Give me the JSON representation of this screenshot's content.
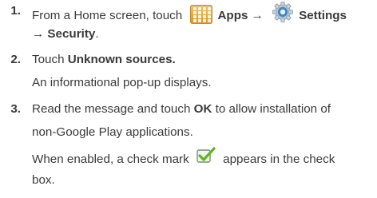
{
  "steps": [
    {
      "number": "1.",
      "line1_prefix": "From a Home screen, touch ",
      "apps_label": "Apps",
      "arrow1": " → ",
      "settings_label": "Settings",
      "line2": "→ Security",
      "line2_end": "."
    },
    {
      "number": "2.",
      "prefix": "Touch ",
      "unknown_sources": "Unknown sources.",
      "line2": "An informational pop-up displays."
    },
    {
      "number": "3.",
      "line1_prefix": "Read the message and touch ",
      "ok_label": "OK",
      "line1_suffix": " to allow installation of",
      "line2": "non-Google Play applications.",
      "line3_prefix": "When enabled, a check mark ",
      "line3_suffix": " appears in the check",
      "line4": "box."
    }
  ],
  "icons": {
    "apps": "apps-grid-icon",
    "settings": "settings-gear-icon",
    "check": "checkmark-box-icon"
  },
  "colors": {
    "text": "#3a3a3a",
    "apps_icon": "#e0a33a",
    "settings_icon": "#3a86c8",
    "check": "#58b81c"
  }
}
